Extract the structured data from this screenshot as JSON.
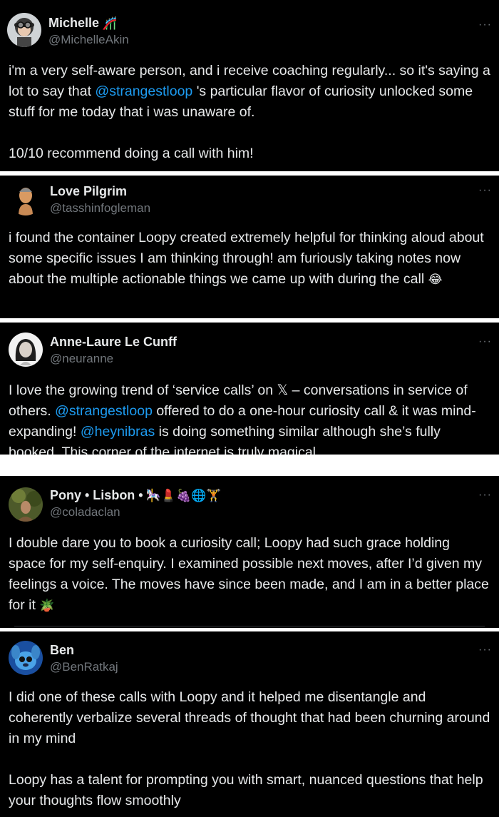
{
  "tweets": [
    {
      "name": "Michelle",
      "name_emoji": "🎢",
      "handle": "@MichelleAkin",
      "more": "···",
      "paragraphs": [
        [
          "i'm a very self-aware person, and i receive coaching regularly... so it's saying a lot to say that ",
          "@strangestloop",
          " 's particular flavor of curiosity unlocked some stuff for me today that i was unaware of."
        ],
        [
          "10/10 recommend doing a call with him!"
        ]
      ]
    },
    {
      "name": "Love Pilgrim",
      "handle": "@tasshinfogleman",
      "more": "···",
      "text": "i found the container Loopy created extremely helpful for thinking aloud about some specific issues I am thinking through! am furiously taking notes now about the multiple actionable things we came up with during the call",
      "text_emoji": "😂"
    },
    {
      "name": "Anne-Laure Le Cunff",
      "handle": "@neuranne",
      "more": "···",
      "parts": [
        "I love the growing trend of ‘service calls’ on ",
        "𝕏",
        " – conversations in service of others. ",
        "@strangestloop",
        " offered to do a one-hour curiosity call & it was mind-expanding! ",
        "@heynibras",
        " is doing something similar although she’s fully booked. This corner of the internet is truly magical."
      ]
    },
    {
      "name": "Pony • Lisbon •",
      "name_emoji": "🎠💄🍇🌐🏋",
      "handle": "@coladaclan",
      "more": "···",
      "text": "I double dare you to book a curiosity call; Loopy had such grace holding space for my self-enquiry. I examined possible next moves, after I’d given my feelings a voice. The moves have since been made, and I am in a better place for it",
      "text_emoji": "🪴"
    },
    {
      "name": "Ben",
      "handle": "@BenRatkaj",
      "more": "···",
      "paragraphs": [
        "I did one of these calls with Loopy and it helped me disentangle and coherently verbalize several threads of thought that had been churning around in my mind",
        "Loopy has a talent for prompting you with smart, nuanced questions that help your thoughts flow smoothly"
      ]
    }
  ]
}
